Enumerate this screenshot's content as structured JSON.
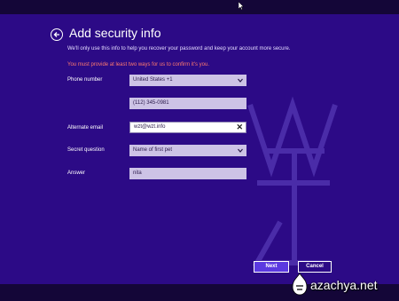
{
  "header": {
    "title": "Add security info",
    "subtitle": "We'll only use this info to help you recover your password and keep your account more secure.",
    "warning": "You must provide at least two ways for us to confirm it's you."
  },
  "form": {
    "phone_label": "Phone number",
    "phone_country": "United States +1",
    "phone_number": "(112) 345-0981",
    "alt_email_label": "Alternate email",
    "alt_email_value": "wzt@wzt.info",
    "question_label": "Secret question",
    "question_value": "Name of first pet",
    "answer_label": "Answer",
    "answer_value": "nita"
  },
  "buttons": {
    "next": "Next",
    "cancel": "Cancel"
  },
  "watermark": {
    "text": "azachya.net"
  },
  "colors": {
    "background": "#2c0a86",
    "warning": "#ff7a6e",
    "primary_button": "#5b39e0"
  }
}
